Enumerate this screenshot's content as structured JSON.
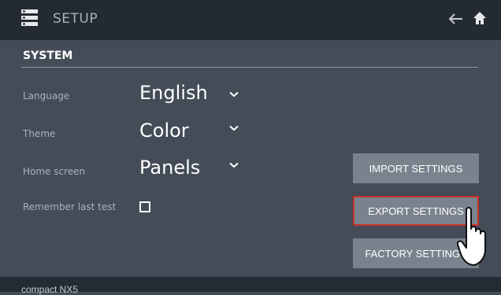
{
  "header": {
    "title": "SETUP",
    "app_icon": "menu-grid-icon",
    "back_icon": "arrow-left-icon",
    "home_icon": "home-icon"
  },
  "section": {
    "title": "SYSTEM"
  },
  "settings": {
    "language": {
      "label": "Language",
      "value": "English"
    },
    "theme": {
      "label": "Theme",
      "value": "Color"
    },
    "home_screen": {
      "label": "Home screen",
      "value": "Panels"
    },
    "remember_last_test": {
      "label": "Remember last test",
      "checked": false
    }
  },
  "actions": {
    "import": "IMPORT SETTINGS",
    "export": "EXPORT SETTINGS",
    "factory": "FACTORY SETTINGS"
  },
  "footer": {
    "device_name": "compact NX5"
  },
  "colors": {
    "background": "#434c57",
    "header_bg": "#232a31",
    "button_bg": "#7a838d",
    "highlight": "#c8302b"
  }
}
